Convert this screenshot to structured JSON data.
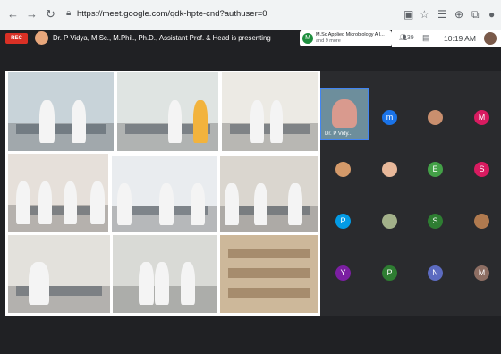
{
  "browser": {
    "back_icon": "←",
    "forward_icon": "→",
    "reload_icon": "↻",
    "url": "https://meet.google.com/qdk-hpte-cnd?authuser=0"
  },
  "meet": {
    "rec_label": "REC",
    "presenting_text": "Dr. P Vidya, M.Sc., M.Phil., Ph.D., Assistant Prof. & Head is presenting",
    "chip_avatar": "M",
    "chip_line1": "M.Sc Applied Microbiology A I...",
    "chip_line2": "and 9 more",
    "participant_count": "39",
    "clock": "10:19 AM"
  },
  "participants": [
    {
      "label": "Dr. P Vidy...",
      "type": "video"
    },
    {
      "initial": "m",
      "color": "#1a73e8"
    },
    {
      "initial": "",
      "color": "#c98f6e",
      "type": "photo"
    },
    {
      "initial": "M",
      "color": "#d81b60"
    },
    {
      "initial": "",
      "color": "#d49a6a",
      "type": "photo"
    },
    {
      "initial": "",
      "color": "#e8b89a",
      "type": "photo"
    },
    {
      "initial": "E",
      "color": "#43a047"
    },
    {
      "initial": "S",
      "color": "#d81b60"
    },
    {
      "initial": "P",
      "color": "#039be5"
    },
    {
      "initial": "",
      "color": "#a3b18a",
      "type": "photo"
    },
    {
      "initial": "S",
      "color": "#2e7d32"
    },
    {
      "initial": "",
      "color": "#b07a4f",
      "type": "photo"
    },
    {
      "initial": "Y",
      "color": "#7b1fa2"
    },
    {
      "initial": "P",
      "color": "#2e7d32"
    },
    {
      "initial": "N",
      "color": "#5c6bc0"
    },
    {
      "initial": "M",
      "color": "#8d6e63"
    }
  ]
}
